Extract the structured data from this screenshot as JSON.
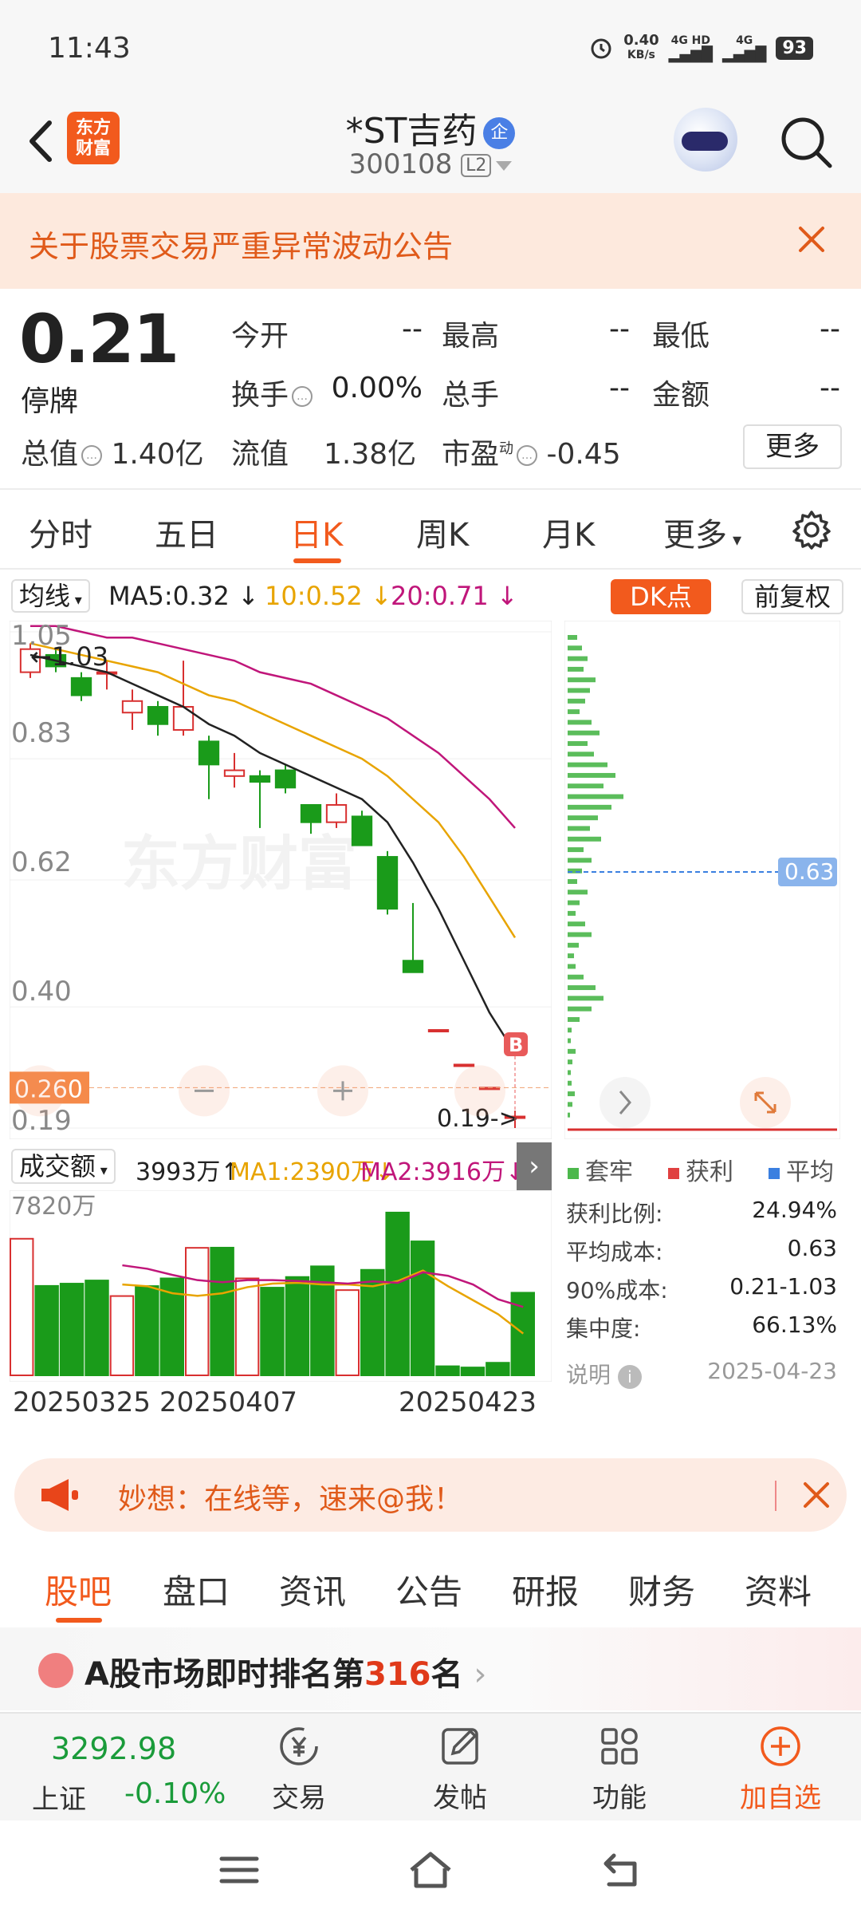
{
  "status_bar": {
    "time": "11:43",
    "net_speed": "0.40",
    "net_unit": "KB/s",
    "net1": "4G HD",
    "net2": "4G",
    "battery": "93"
  },
  "header": {
    "logo_text_1": "东方",
    "logo_text_2": "财富",
    "title": "*ST吉药",
    "title_badge": "企",
    "code": "300108",
    "level": "L2"
  },
  "notice": {
    "text": "关于股票交易严重异常波动公告"
  },
  "quote": {
    "price": "0.21",
    "state": "停牌",
    "rows": [
      {
        "label": "今开",
        "value": "--"
      },
      {
        "label": "最高",
        "value": "--"
      },
      {
        "label": "最低",
        "value": "--"
      },
      {
        "label": "换手",
        "value": "0.00%"
      },
      {
        "label": "总手",
        "value": "--"
      },
      {
        "label": "金额",
        "value": "--"
      }
    ],
    "total_mv_label": "总值",
    "total_mv": "1.40亿",
    "float_mv_label": "流值",
    "float_mv": "1.38亿",
    "pe_label": "市盈",
    "pe_sup": "动",
    "pe": "-0.45",
    "more": "更多"
  },
  "tabs": [
    {
      "label": "分时",
      "active": false
    },
    {
      "label": "五日",
      "active": false
    },
    {
      "label": "日K",
      "active": true
    },
    {
      "label": "周K",
      "active": false
    },
    {
      "label": "月K",
      "active": false
    },
    {
      "label": "更多",
      "active": false
    }
  ],
  "chart_toolbar": {
    "indicator": "均线",
    "ma5": "MA5:0.32",
    "ma10": "10:0.52",
    "ma20": "20:0.71",
    "dk": "DK点",
    "adjust": "前复权",
    "colors": {
      "ma5": "#222222",
      "ma10": "#e8a400",
      "ma20": "#c0167a",
      "up": "#d83030",
      "down": "#1a9b1a"
    }
  },
  "chart_data": {
    "type": "candlestick",
    "y_ticks": [
      "1.05",
      "0.83",
      "0.62",
      "0.40",
      "0.19"
    ],
    "ylim": [
      0.19,
      1.05
    ],
    "high_marker": "1.03",
    "low_marker": "0.19",
    "current_marker": "0.260",
    "buy_marker": "B",
    "candles": [
      {
        "o": 0.98,
        "c": 1.02,
        "h": 1.03,
        "l": 0.97
      },
      {
        "o": 1.01,
        "c": 0.99,
        "h": 1.02,
        "l": 0.98
      },
      {
        "o": 0.97,
        "c": 0.94,
        "h": 0.98,
        "l": 0.93
      },
      {
        "o": 0.98,
        "c": 0.98,
        "h": 1.0,
        "l": 0.95
      },
      {
        "o": 0.91,
        "c": 0.93,
        "h": 0.95,
        "l": 0.88
      },
      {
        "o": 0.92,
        "c": 0.89,
        "h": 0.93,
        "l": 0.87
      },
      {
        "o": 0.88,
        "c": 0.92,
        "h": 1.0,
        "l": 0.87
      },
      {
        "o": 0.86,
        "c": 0.82,
        "h": 0.87,
        "l": 0.76
      },
      {
        "o": 0.8,
        "c": 0.81,
        "h": 0.84,
        "l": 0.78
      },
      {
        "o": 0.8,
        "c": 0.79,
        "h": 0.81,
        "l": 0.71
      },
      {
        "o": 0.81,
        "c": 0.78,
        "h": 0.82,
        "l": 0.77
      },
      {
        "o": 0.75,
        "c": 0.72,
        "h": 0.75,
        "l": 0.7
      },
      {
        "o": 0.72,
        "c": 0.75,
        "h": 0.77,
        "l": 0.71
      },
      {
        "o": 0.73,
        "c": 0.68,
        "h": 0.74,
        "l": 0.68
      },
      {
        "o": 0.66,
        "c": 0.57,
        "h": 0.67,
        "l": 0.56
      },
      {
        "o": 0.48,
        "c": 0.46,
        "h": 0.58,
        "l": 0.46
      },
      {
        "o": 0.36,
        "c": 0.36,
        "h": 0.36,
        "l": 0.36
      },
      {
        "o": 0.3,
        "c": 0.3,
        "h": 0.3,
        "l": 0.3
      },
      {
        "o": 0.26,
        "c": 0.26,
        "h": 0.26,
        "l": 0.26
      },
      {
        "o": 0.21,
        "c": 0.21,
        "h": 0.22,
        "l": 0.19
      }
    ],
    "ma5_line": [
      1.01,
      1.0,
      0.99,
      0.98,
      0.96,
      0.94,
      0.92,
      0.89,
      0.87,
      0.84,
      0.82,
      0.8,
      0.78,
      0.76,
      0.72,
      0.65,
      0.57,
      0.48,
      0.39,
      0.32
    ],
    "ma10_line": [
      1.03,
      1.02,
      1.01,
      1.0,
      0.99,
      0.98,
      0.96,
      0.94,
      0.93,
      0.91,
      0.89,
      0.87,
      0.85,
      0.83,
      0.8,
      0.76,
      0.72,
      0.66,
      0.59,
      0.52
    ],
    "ma20_line": [
      1.06,
      1.06,
      1.05,
      1.04,
      1.04,
      1.03,
      1.02,
      1.01,
      1.0,
      0.98,
      0.97,
      0.96,
      0.94,
      0.92,
      0.9,
      0.87,
      0.84,
      0.8,
      0.76,
      0.71
    ],
    "volume": {
      "max_label": "7820万",
      "values": [
        7820,
        5120,
        5250,
        5430,
        4540,
        5110,
        5550,
        7300,
        7310,
        5550,
        5020,
        5630,
        6240,
        4880,
        6040,
        9320,
        7670,
        520,
        450,
        720,
        4730
      ],
      "up": [
        true,
        false,
        false,
        false,
        true,
        false,
        false,
        true,
        false,
        true,
        false,
        false,
        false,
        true,
        false,
        false,
        false,
        false,
        false,
        false,
        false
      ],
      "ma1_line": [
        null,
        null,
        null,
        null,
        5200,
        5100,
        4700,
        4550,
        4700,
        5050,
        5250,
        5300,
        5200,
        5200,
        5100,
        5400,
        6000,
        5100,
        4300,
        3500,
        2390
      ],
      "ma2_line": [
        null,
        null,
        null,
        null,
        6300,
        6100,
        5750,
        5450,
        5330,
        5450,
        5450,
        5400,
        5330,
        5250,
        5380,
        5300,
        5900,
        5700,
        5200,
        4350,
        3916
      ]
    },
    "x_labels": [
      "20250325",
      "20250407",
      "20250423"
    ]
  },
  "chip": {
    "avg_price": "0.63",
    "legend": [
      "套牢",
      "获利",
      "平均"
    ],
    "rows": [
      {
        "label": "获利比例:",
        "value": "24.94%"
      },
      {
        "label": "平均成本:",
        "value": "0.63"
      },
      {
        "label": "90%成本:",
        "value": "0.21-1.03"
      },
      {
        "label": "集中度:",
        "value": "66.13%"
      }
    ],
    "note_label": "说明",
    "date": "2025-04-23",
    "bars": [
      0.12,
      0.18,
      0.25,
      0.2,
      0.35,
      0.28,
      0.22,
      0.15,
      0.3,
      0.4,
      0.25,
      0.33,
      0.5,
      0.6,
      0.45,
      0.7,
      0.55,
      0.38,
      0.28,
      0.42,
      0.2,
      0.3,
      0.18,
      0.12,
      0.25,
      0.15,
      0.1,
      0.22,
      0.3,
      0.14,
      0.08,
      0.1,
      0.2,
      0.35,
      0.45,
      0.3,
      0.15,
      0.05,
      0.04,
      0.1,
      0.06,
      0.04,
      0.05,
      0.09,
      0.06,
      0.03
    ]
  },
  "volume_bar": {
    "indicator": "成交额",
    "value": "3993万↑",
    "ma1": "MA1:2390万↓",
    "ma2": "MA2:3916万↓"
  },
  "promo": {
    "text": "妙想：在线等，速来@我！"
  },
  "bottom_tabs": [
    {
      "label": "股吧",
      "active": true
    },
    {
      "label": "盘口",
      "active": false
    },
    {
      "label": "资讯",
      "active": false
    },
    {
      "label": "公告",
      "active": false
    },
    {
      "label": "研报",
      "active": false
    },
    {
      "label": "财务",
      "active": false
    },
    {
      "label": "资料",
      "active": false
    }
  ],
  "rank": {
    "prefix": "A股市场即时排名第",
    "num": "316",
    "suffix": "名"
  },
  "bottom_nav": {
    "index_value": "3292.98",
    "index_name": "上证",
    "index_pct": "-0.10%",
    "items": [
      "交易",
      "发帖",
      "功能",
      "加自选"
    ]
  }
}
